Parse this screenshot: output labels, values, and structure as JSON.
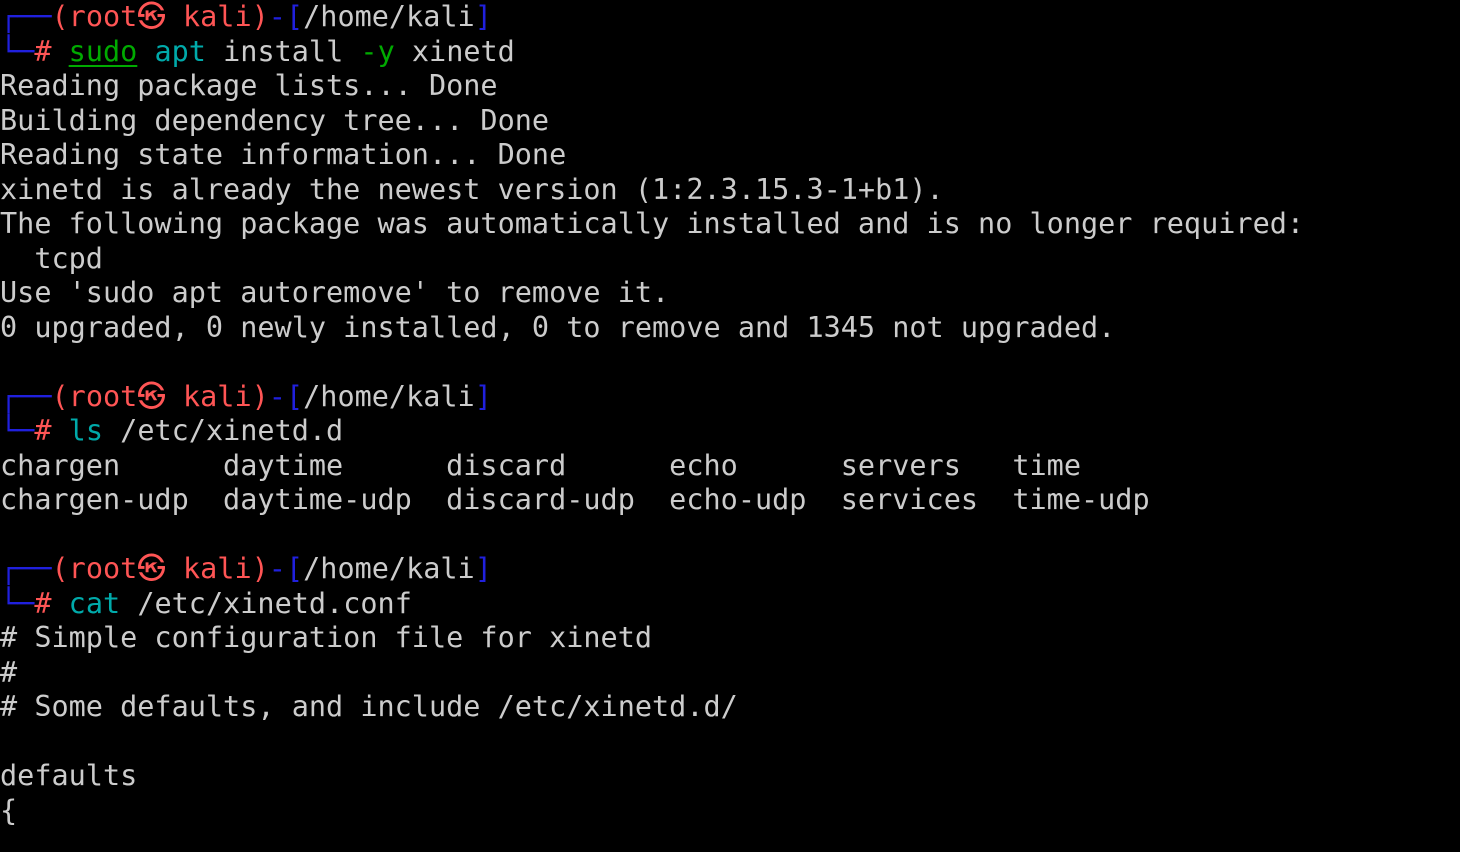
{
  "terminal": {
    "background_color": "#000000",
    "foreground_color": "#cccccc",
    "colors": {
      "prompt_box": "#2020dd",
      "prompt_user_host": "#ff5555",
      "prompt_hash": "#ff5555",
      "command_builtin": "#00aaaa",
      "command_sudo": "#00aa00",
      "flag": "#00aa00",
      "path_text": "#cccccc",
      "output": "#cccccc"
    },
    "prompt": {
      "box_top": "┌──",
      "box_bottom": "└─",
      "open_paren": "(",
      "user": "root",
      "kali_glyph": "㉿",
      "host": " kali",
      "close_paren": ")",
      "dash": "-",
      "bracket_open": "[",
      "cwd": "/home/kali",
      "bracket_close": "]",
      "sigil": "#"
    },
    "blocks": [
      {
        "name": "apt-install-xinetd",
        "command_parts": [
          {
            "text": "sudo",
            "style": "sudo"
          },
          {
            "text": " ",
            "style": "plain"
          },
          {
            "text": "apt",
            "style": "builtin"
          },
          {
            "text": " install ",
            "style": "plain"
          },
          {
            "text": "-y",
            "style": "flag"
          },
          {
            "text": " xinetd",
            "style": "plain"
          }
        ],
        "command_plain": "sudo apt install -y xinetd",
        "output": [
          "Reading package lists... Done",
          "Building dependency tree... Done",
          "Reading state information... Done",
          "xinetd is already the newest version (1:2.3.15.3-1+b1).",
          "The following package was automatically installed and is no longer required:",
          "  tcpd",
          "Use 'sudo apt autoremove' to remove it.",
          "0 upgraded, 0 newly installed, 0 to remove and 1345 not upgraded."
        ]
      },
      {
        "name": "ls-xinetd-d",
        "command_parts": [
          {
            "text": "ls",
            "style": "builtin"
          },
          {
            "text": " /etc/xinetd.d",
            "style": "plain"
          }
        ],
        "command_plain": "ls /etc/xinetd.d",
        "output": [
          "chargen      daytime      discard      echo      servers   time",
          "chargen-udp  daytime-udp  discard-udp  echo-udp  services  time-udp"
        ],
        "listing_columns": [
          [
            "chargen",
            "chargen-udp"
          ],
          [
            "daytime",
            "daytime-udp"
          ],
          [
            "discard",
            "discard-udp"
          ],
          [
            "echo",
            "echo-udp"
          ],
          [
            "servers",
            "services"
          ],
          [
            "time",
            "time-udp"
          ]
        ]
      },
      {
        "name": "cat-xinetd-conf",
        "command_parts": [
          {
            "text": "cat",
            "style": "builtin"
          },
          {
            "text": " /etc/xinetd.conf",
            "style": "plain"
          }
        ],
        "command_plain": "cat /etc/xinetd.conf",
        "output": [
          "# Simple configuration file for xinetd",
          "#",
          "# Some defaults, and include /etc/xinetd.d/",
          "",
          "defaults",
          "{"
        ]
      }
    ]
  }
}
